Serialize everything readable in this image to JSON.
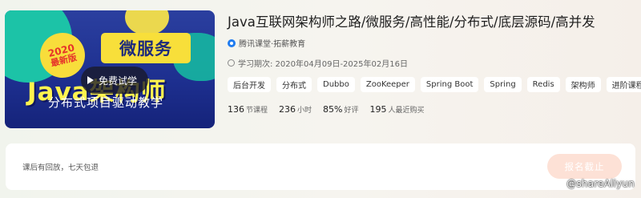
{
  "cover": {
    "badge_year": "2020",
    "badge_text": "最新版",
    "tag": "微服务",
    "headline": "Java架构师",
    "subline": "分布式项目驱动教学",
    "play_label": "免费试学"
  },
  "course": {
    "title": "Java互联网架构师之路/微服务/高性能/分布式/底层源码/高并发",
    "org": "腾讯课堂·拓薪教育",
    "period": "学习期次: 2020年04月09日-2025年02月16日",
    "tags": [
      "后台开发",
      "分布式",
      "Dubbo",
      "ZooKeeper",
      "Spring Boot",
      "Spring",
      "Redis",
      "架构师",
      "进阶课程"
    ],
    "stats": [
      {
        "value": "136",
        "unit": "节课程"
      },
      {
        "value": "236",
        "unit": "小时"
      },
      {
        "value": "85%",
        "unit": "好评"
      },
      {
        "value": "195",
        "unit": "人最近购买"
      }
    ]
  },
  "purchase": {
    "note": "课后有回放，七天包退",
    "button_label": "报名截止"
  },
  "watermark": "@shareAliyun",
  "colors": {
    "accent_yellow": "#f8df3a",
    "cover_blue": "#1d2f8f",
    "button_disabled": "#fde1d6",
    "org_icon": "#1f7cf0"
  }
}
